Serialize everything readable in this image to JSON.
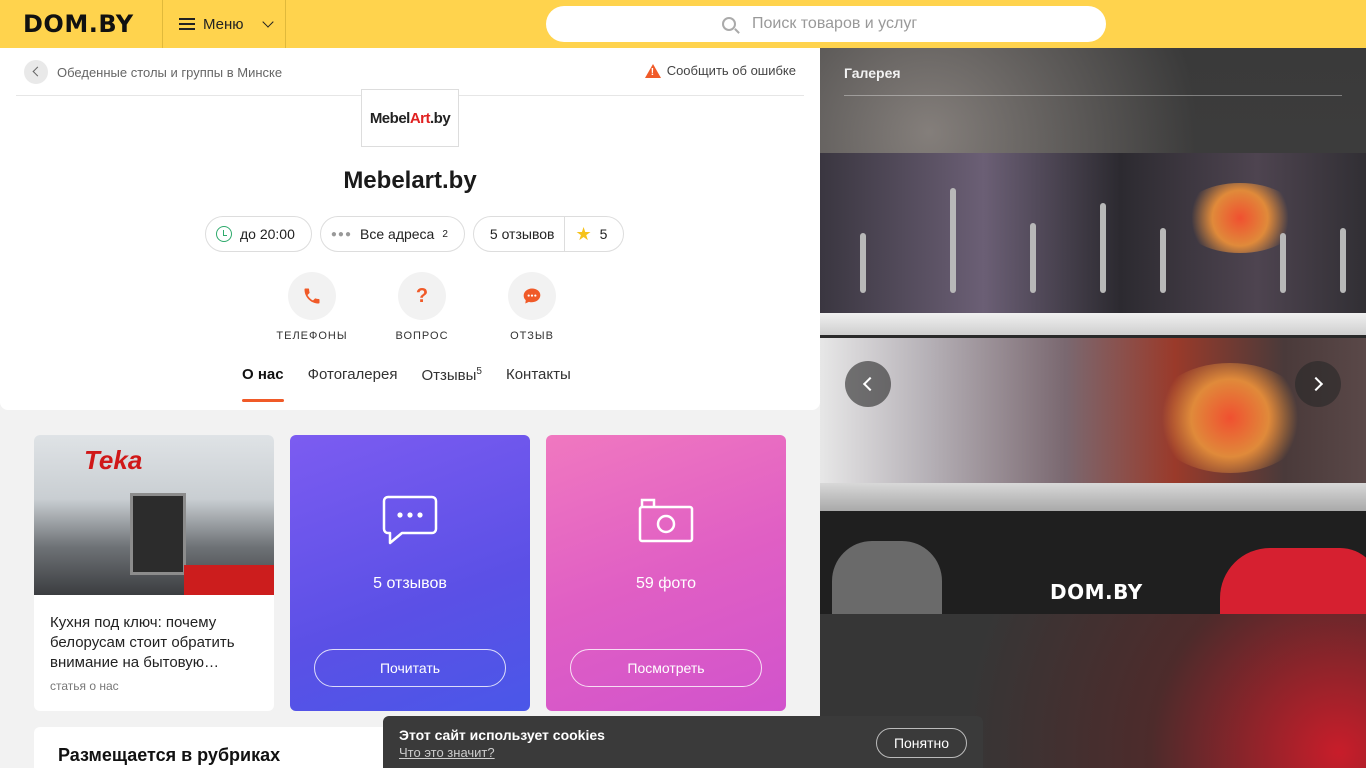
{
  "header": {
    "logo": "DOM.BY",
    "menu_label": "Меню",
    "search_placeholder": "Поиск товаров и услуг"
  },
  "breadcrumb": {
    "back_label": "Обеденные столы и группы в Минске",
    "report_label": "Сообщить об ошибке"
  },
  "company": {
    "logo_text_1": "Mebel",
    "logo_text_red": "Art",
    "logo_text_2": ".by",
    "name": "Mebelart.by",
    "hours": "до 20:00",
    "addresses_label": "Все адреса",
    "addresses_count": "2",
    "reviews_label": "5 отзывов",
    "rating": "5"
  },
  "actions": [
    {
      "label": "ТЕЛЕФОНЫ",
      "icon": "phone-icon"
    },
    {
      "label": "ВОПРОС",
      "icon": "question-icon"
    },
    {
      "label": "ОТЗЫВ",
      "icon": "chat-icon"
    }
  ],
  "tabs": [
    {
      "label": "О нас",
      "active": true
    },
    {
      "label": "Фотогалерея"
    },
    {
      "label": "Отзывы",
      "count": "5"
    },
    {
      "label": "Контакты"
    }
  ],
  "cards": {
    "article": {
      "title": "Кухня под ключ: почему белорусам стоит обратить внимание на бытовую…",
      "sub": "статья о нас",
      "image_brand": "Teka"
    },
    "reviews": {
      "text": "5 отзывов",
      "button": "Почитать",
      "color": "#6a55ec"
    },
    "photos": {
      "text": "59 фото",
      "button": "Посмотреть",
      "color": "#e36ac5"
    }
  },
  "rubrics_title": "Размещается в рубриках",
  "gallery": {
    "title": "Галерея",
    "watermark": "DOM.BY"
  },
  "cookie": {
    "text": "Этот сайт использует cookies",
    "link": "Что это значит?",
    "button": "Понятно"
  },
  "colors": {
    "brand_yellow": "#ffd34d",
    "accent_orange": "#f05a28"
  }
}
